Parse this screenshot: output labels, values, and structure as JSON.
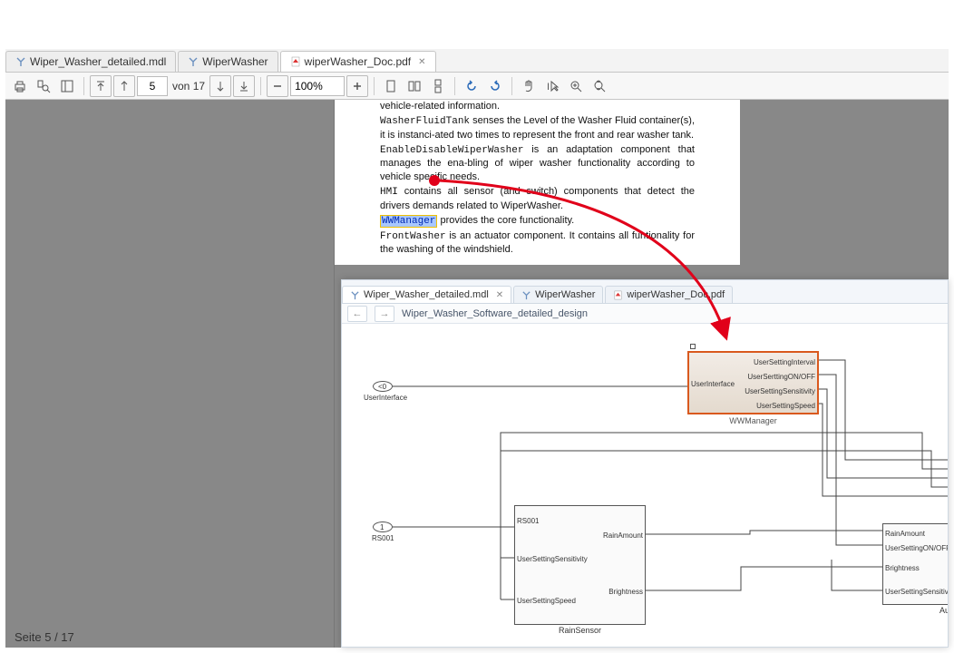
{
  "pdf_window": {
    "tabs": [
      {
        "label": "Wiper_Washer_detailed.mdl",
        "kind": "model"
      },
      {
        "label": "WiperWasher",
        "kind": "model"
      },
      {
        "label": "wiperWasher_Doc.pdf",
        "kind": "pdf",
        "active": true,
        "closable": true
      }
    ],
    "toolbar": {
      "page_field": "5",
      "von": "von",
      "total_pages": "17",
      "zoom": "100%"
    },
    "content": {
      "line0_tail": "vehicle-related information.",
      "wft": "WasherFluidTank",
      "wft_text": " senses the Level of the Washer Fluid container(s), it is instanci-ated two times to represent the front and rear washer tank.",
      "edww": "EnableDisableWiperWasher",
      "edww_text": " is an adaptation component that manages the ena-bling of wiper washer functionality according to vehicle specific needs.",
      "hmi": "HMI",
      "hmi_text": " contains all sensor (and switch) components that detect the drivers demands related to WiperWasher.",
      "wwm": "WWManager",
      "wwm_text": " provides the core functionality.",
      "fw": "FrontWasher",
      "fw_text": " is an actuator component. It contains all funtionality for the washing of the windshield."
    },
    "page_status": "Seite 5 / 17"
  },
  "model_window": {
    "tabs": [
      {
        "label": "Wiper_Washer_detailed.mdl",
        "kind": "model",
        "active": true,
        "closable": true
      },
      {
        "label": "WiperWasher",
        "kind": "model"
      },
      {
        "label": "wiperWasher_Doc.pdf",
        "kind": "pdf"
      }
    ],
    "breadcrumb": "Wiper_Washer_Software_detailed_design",
    "blocks": {
      "userinterface": {
        "oval_label": "UserInterface",
        "oval_num": "<0"
      },
      "wwmanager": {
        "title": "WWManager",
        "port_in": "UserInterface",
        "ports_out": [
          "UserSettingInterval",
          "UserSerttingON/OFF",
          "UserSettingSensitivity",
          "UserSettingSpeed"
        ]
      },
      "rs001": {
        "oval_label": "RS001",
        "oval_num": "1"
      },
      "rainsensor": {
        "title": "RainSensor",
        "ports_in": [
          "RS001",
          "UserSettingSensitivity",
          "UserSettingSpeed"
        ],
        "ports_out": [
          "RainAmount",
          "Brightness"
        ]
      },
      "rightblock": {
        "ports_in": [
          "RainAmount",
          "UserSettingON/OFF",
          "Brightness",
          "UserSettingSensitivity"
        ],
        "title_partial": "AutoWip"
      }
    }
  }
}
